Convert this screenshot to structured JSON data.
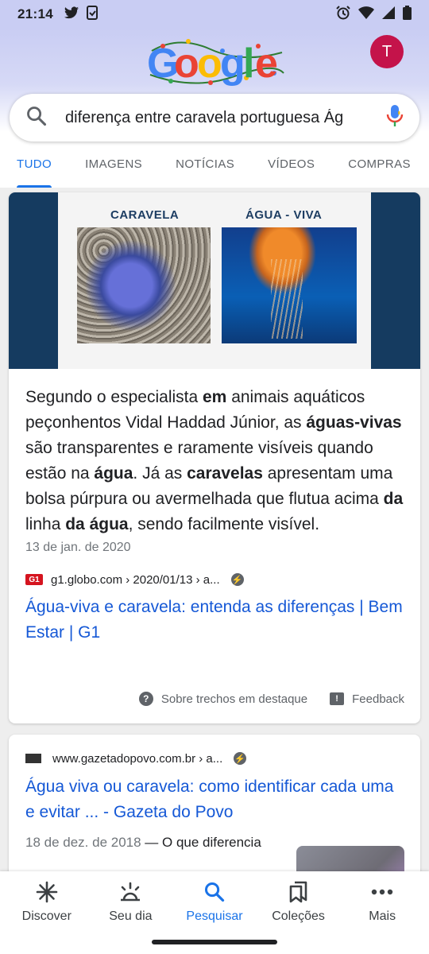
{
  "status": {
    "time": "21:14"
  },
  "header": {
    "doodle_text": "Google",
    "avatar_letter": "T"
  },
  "search": {
    "query": "diferença entre caravela portuguesa Ág"
  },
  "tabs": [
    {
      "label": "TUDO",
      "active": true
    },
    {
      "label": "IMAGENS"
    },
    {
      "label": "NOTÍCIAS"
    },
    {
      "label": "VÍDEOS"
    },
    {
      "label": "COMPRAS"
    }
  ],
  "featured": {
    "image_labels": {
      "left": "CARAVELA",
      "right": "ÁGUA - VIVA"
    },
    "snippet_parts": [
      {
        "t": "Segundo o especialista ",
        "b": false
      },
      {
        "t": "em",
        "b": true
      },
      {
        "t": " animais aquáticos peçonhentos Vidal Haddad Júnior, as ",
        "b": false
      },
      {
        "t": "águas-vivas",
        "b": true
      },
      {
        "t": " são transparentes e raramente visíveis quando estão na ",
        "b": false
      },
      {
        "t": "água",
        "b": true
      },
      {
        "t": ". Já as ",
        "b": false
      },
      {
        "t": "caravelas",
        "b": true
      },
      {
        "t": " apresentam uma bolsa púrpura ou avermelhada que flutua acima ",
        "b": false
      },
      {
        "t": "da",
        "b": true
      },
      {
        "t": " linha ",
        "b": false
      },
      {
        "t": "da",
        "b": true
      },
      {
        "t": " ",
        "b": false
      },
      {
        "t": "água",
        "b": true
      },
      {
        "t": ", sendo facilmente visível.",
        "b": false
      }
    ],
    "date": "13 de jan. de 2020",
    "source_logo": "G1",
    "source_url": "g1.globo.com › 2020/01/13 › a...",
    "title": "Água-viva e caravela: entenda as diferenças | Bem Estar | G1",
    "about_label": "Sobre trechos em destaque",
    "feedback_label": "Feedback"
  },
  "result2": {
    "source_url": "www.gazetadopovo.com.br › a...",
    "title": "Água viva ou caravela: como identificar cada uma e evitar ... - Gazeta do Povo",
    "date": "18 de dez. de 2018",
    "desc": " — O que diferencia"
  },
  "bottom_nav": [
    {
      "label": "Discover",
      "icon": "asterisk-icon"
    },
    {
      "label": "Seu dia",
      "icon": "sunrise-icon"
    },
    {
      "label": "Pesquisar",
      "icon": "search-icon",
      "active": true
    },
    {
      "label": "Coleções",
      "icon": "bookmarks-icon"
    },
    {
      "label": "Mais",
      "icon": "more-dots-icon"
    }
  ],
  "colors": {
    "accent": "#1a73e8",
    "link": "#1558d6",
    "header_bg": "#c9cdf3",
    "avatar": "#c4134a",
    "g1_red": "#d5141f"
  }
}
